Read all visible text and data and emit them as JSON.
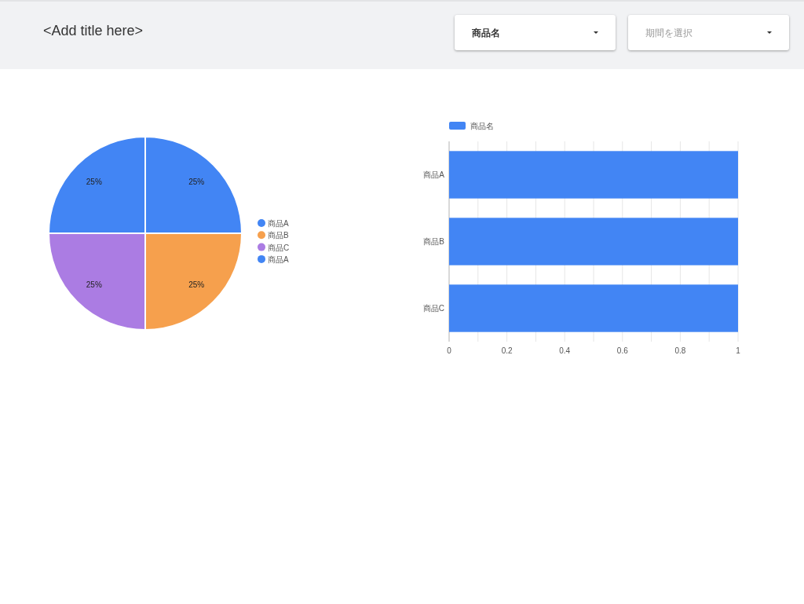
{
  "header": {
    "title": "<Add title here>"
  },
  "filters": [
    {
      "kind": "value",
      "value": "商品名"
    },
    {
      "kind": "placeholder",
      "placeholder": "期間を選択"
    }
  ],
  "pie_chart": {
    "chart_data": {
      "type": "pie",
      "categories": [
        "商品A",
        "商品B",
        "商品C",
        "商品A"
      ],
      "colors": [
        "#4285f4",
        "#f6a04d",
        "#ab7ce3",
        "#4285f4"
      ],
      "values": [
        25,
        25,
        25,
        25
      ],
      "legend": "right",
      "value_labels": [
        "25%",
        "25%",
        "25%",
        "25%"
      ]
    }
  },
  "bar_chart": {
    "chart_data": {
      "type": "bar",
      "orientation": "horizontal",
      "categories": [
        "商品A",
        "商品B",
        "商品C"
      ],
      "series": [
        {
          "name": "商品名",
          "color": "#4285f4",
          "values": [
            1,
            1,
            1
          ]
        }
      ],
      "legend": "top",
      "grid": true,
      "xlim": [
        0,
        1
      ],
      "xticks": [
        0,
        0.2,
        0.4,
        0.6,
        0.8,
        1
      ]
    }
  }
}
